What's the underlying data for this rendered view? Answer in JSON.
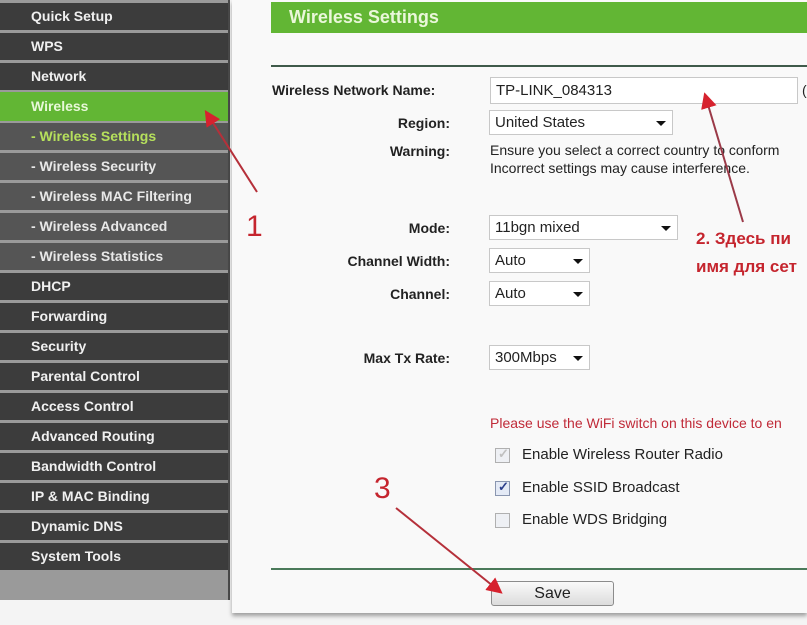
{
  "sidebar": {
    "items": [
      {
        "label": "Quick Setup"
      },
      {
        "label": "WPS"
      },
      {
        "label": "Network"
      },
      {
        "label": "Wireless"
      },
      {
        "label": "- Wireless Settings"
      },
      {
        "label": "- Wireless Security"
      },
      {
        "label": "- Wireless MAC Filtering"
      },
      {
        "label": "- Wireless Advanced"
      },
      {
        "label": "- Wireless Statistics"
      },
      {
        "label": "DHCP"
      },
      {
        "label": "Forwarding"
      },
      {
        "label": "Security"
      },
      {
        "label": "Parental Control"
      },
      {
        "label": "Access Control"
      },
      {
        "label": "Advanced Routing"
      },
      {
        "label": "Bandwidth Control"
      },
      {
        "label": "IP & MAC Binding"
      },
      {
        "label": "Dynamic DNS"
      },
      {
        "label": "System Tools"
      }
    ],
    "active": "Wireless",
    "active_sub": "- Wireless Settings"
  },
  "page": {
    "title": "Wireless Settings"
  },
  "form": {
    "network_name": {
      "label": "Wireless Network Name:",
      "value": "TP-LINK_084313",
      "suffix": "("
    },
    "region": {
      "label": "Region:",
      "value": "United States"
    },
    "warning": {
      "label": "Warning:",
      "line1": "Ensure you select a correct country to conform",
      "line2": "Incorrect settings may cause interference."
    },
    "mode": {
      "label": "Mode:",
      "value": "11bgn mixed"
    },
    "channel_width": {
      "label": "Channel Width:",
      "value": "Auto"
    },
    "channel": {
      "label": "Channel:",
      "value": "Auto"
    },
    "max_tx_rate": {
      "label": "Max Tx Rate:",
      "value": "300Mbps"
    },
    "wifi_switch_notice": "Please use the WiFi switch on this device to en",
    "checkboxes": [
      {
        "label": "Enable Wireless Router Radio",
        "checked": true,
        "disabled": true
      },
      {
        "label": "Enable SSID Broadcast",
        "checked": true,
        "disabled": false
      },
      {
        "label": "Enable WDS Bridging",
        "checked": false,
        "disabled": false
      }
    ],
    "save_label": "Save"
  },
  "annotations": {
    "step1": "1",
    "step2_line1": "2. Здесь пи",
    "step2_line2": "имя для сет",
    "step3": "3"
  },
  "colors": {
    "accent_green": "#62b634",
    "sidebar_dark": "#3c3c3c",
    "annotation_red": "#c5252e"
  }
}
